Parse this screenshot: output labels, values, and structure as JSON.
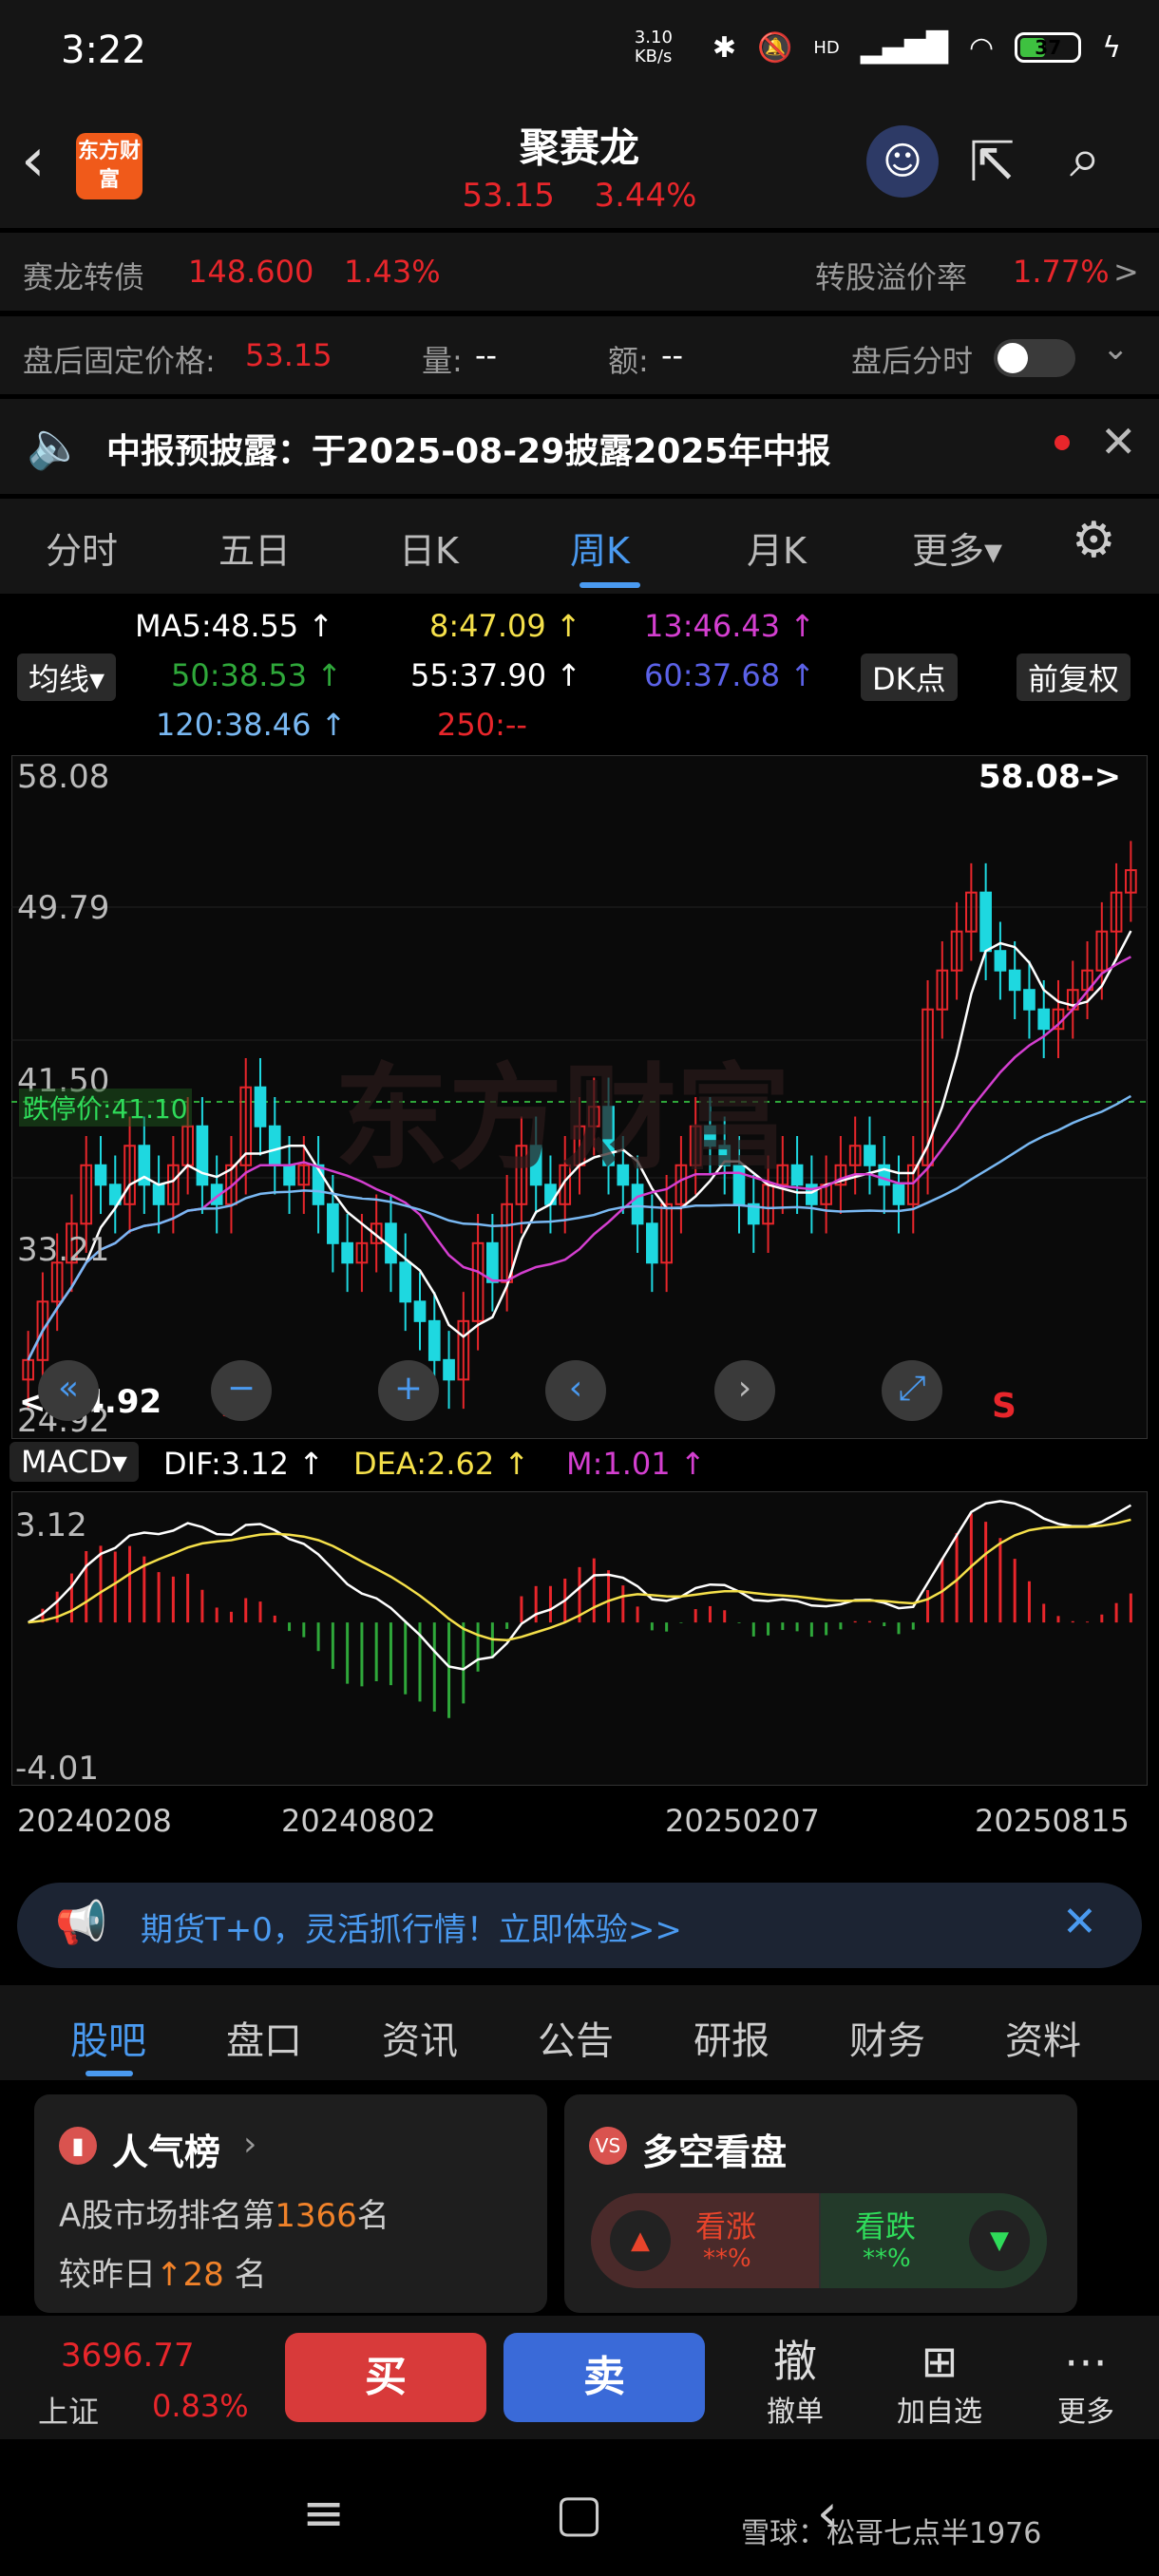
{
  "status_bar": {
    "time": "3:22",
    "net_speed": "3.10 KB/s",
    "signal": "HD",
    "battery": "37"
  },
  "header": {
    "logo_text": "东方财富",
    "stock_name": "聚赛龙",
    "price": "53.15",
    "change_pct": "3.44%"
  },
  "bond_row": {
    "bond_label": "赛龙转债",
    "bond_price": "148.600",
    "bond_pct": "1.43%",
    "premium_label": "转股溢价率",
    "premium_value": "1.77%",
    "chevron": ">"
  },
  "after_hours_row": {
    "fixed_price_label": "盘后固定价格:",
    "fixed_price_value": "53.15",
    "volume_label": "量:",
    "volume_value": "--",
    "amount_label": "额:",
    "amount_value": "--",
    "intraday_label": "盘后分时"
  },
  "notice": {
    "text": "中报预披露：于2025-08-29披露2025年中报"
  },
  "chart_tabs": [
    "分时",
    "五日",
    "日K",
    "周K",
    "月K",
    "更多▾"
  ],
  "active_tab": "周K",
  "ma_legend": {
    "selector": "均线▾",
    "ma5": "MA5:48.55 ↑",
    "ma8": "8:47.09 ↑",
    "ma13": "13:46.43 ↑",
    "ma50": "50:38.53 ↑",
    "ma55": "55:37.90 ↑",
    "ma60": "60:37.68 ↑",
    "ma120": "120:38.46 ↑",
    "ma250": "250:--",
    "dk_button": "DK点",
    "adjust_button": "前复权"
  },
  "colors": {
    "ma5": "#ffffff",
    "ma8": "#f5e04a",
    "ma13": "#d43fd0",
    "ma50": "#2fa83a",
    "ma55": "#ffffff",
    "ma60": "#5b62e8",
    "ma120": "#79b8f2",
    "ma250": "#e8262b",
    "up": "#e8262b",
    "down": "#1ed8e0"
  },
  "price_axis": {
    "max_label": "58.08",
    "l2": "49.79",
    "l3": "41.50",
    "l4": "33.21",
    "min_label": "24.92",
    "max_marker": "58.08->",
    "min_marker": "<-24.92",
    "limit_down": "跌停价:41.10",
    "watermark": "东方财富",
    "sell_marker": "S"
  },
  "macd": {
    "selector": "MACD▾",
    "dif": "DIF:3.12 ↑",
    "dea": "DEA:2.62 ↑",
    "m": "M:1.01 ↑",
    "top": "3.12",
    "bottom": "-4.01"
  },
  "x_axis": [
    "20240208",
    "20240802",
    "20250207",
    "20250815"
  ],
  "chart_data": {
    "type": "candlestick",
    "period": "weekly",
    "ylim": [
      24.92,
      58.08
    ],
    "high": 58.08,
    "low": 24.92,
    "closes": [
      28,
      31,
      33,
      35,
      38,
      37,
      36,
      39,
      37,
      36,
      38,
      40,
      37,
      36,
      38,
      42,
      40,
      38,
      37,
      38,
      36,
      34,
      33,
      34,
      35,
      33,
      31,
      30,
      28,
      27,
      30,
      34,
      32,
      36,
      39,
      37,
      36,
      38,
      40,
      41,
      38,
      37,
      35,
      33,
      36,
      38,
      40,
      39,
      38,
      36,
      35,
      37,
      38,
      37,
      36,
      37,
      38,
      39,
      38,
      37,
      36,
      38,
      46,
      48,
      50,
      52,
      49,
      48,
      47,
      46,
      45,
      46,
      47,
      48,
      50,
      52,
      53.15
    ],
    "macd_range": [
      -4.01,
      3.12
    ]
  },
  "ad_banner": {
    "text": "期货T+0，灵活抓行情！立即体验>>"
  },
  "lower_tabs": [
    "股吧",
    "盘口",
    "资讯",
    "公告",
    "研报",
    "财务",
    "资料"
  ],
  "popularity_card": {
    "title": "人气榜",
    "rank_prefix": "A股市场排名第",
    "rank": "1366",
    "rank_suffix": "名",
    "change_prefix": "较昨日",
    "change": "28",
    "change_suffix": "名"
  },
  "sentiment_card": {
    "title": "多空看盘",
    "bull": "看涨",
    "bull_pct": "**%",
    "bear": "看跌",
    "bear_pct": "**%"
  },
  "trade_bar": {
    "index_value": "3696.77",
    "index_name": "上证",
    "index_pct": "0.83%",
    "buy": "买",
    "sell": "卖",
    "cancel_icon": "撤",
    "cancel": "撤单",
    "add": "加自选",
    "more": "更多"
  },
  "footer_watermark": "雪球：松哥七点半1976"
}
